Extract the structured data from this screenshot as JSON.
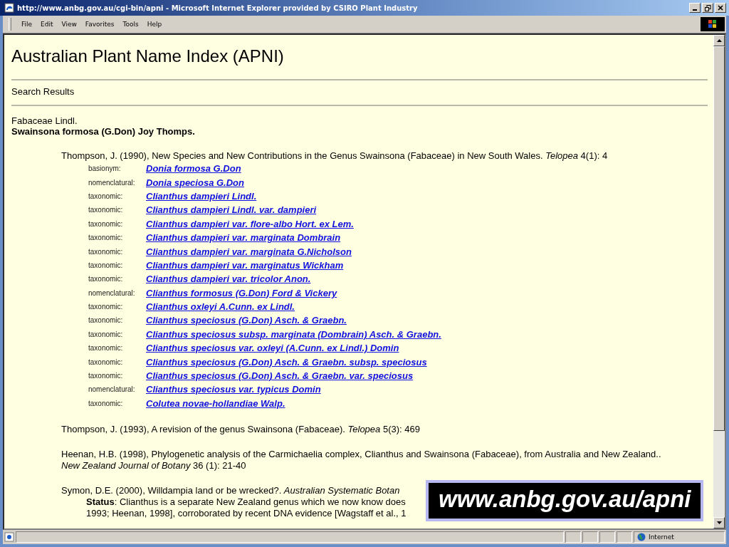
{
  "window": {
    "title": "http://www.anbg.gov.au/cgi-bin/apni - Microsoft Internet Explorer provided by CSIRO Plant Industry"
  },
  "menu": [
    {
      "label": "File"
    },
    {
      "label": "Edit"
    },
    {
      "label": "View"
    },
    {
      "label": "Favorites"
    },
    {
      "label": "Tools"
    },
    {
      "label": "Help"
    }
  ],
  "page": {
    "title": "Australian Plant Name Index (APNI)",
    "subtitle": "Search Results",
    "family": "Fabaceae Lindl.",
    "name": "Swainsona formosa (G.Don) Joy Thomps.",
    "references": [
      {
        "lines": [
          "Thompson, J. (1990), New Species and New Contributions in the Genus Swainsona (Fabaceae) in New South Wales. *Telopea* 4(1): 4"
        ],
        "relations": [
          {
            "type": "basionym:",
            "name": "Donia formosa G.Don"
          },
          {
            "type": "nomenclatural:",
            "name": "Donia speciosa G.Don"
          },
          {
            "type": "taxonomic:",
            "name": "Clianthus dampieri Lindl."
          },
          {
            "type": "taxonomic:",
            "name": "Clianthus dampieri Lindl. var. dampieri"
          },
          {
            "type": "taxonomic:",
            "name": "Clianthus dampieri var. flore-albo Hort. ex Lem."
          },
          {
            "type": "taxonomic:",
            "name": "Clianthus dampieri var. marginata Dombrain"
          },
          {
            "type": "taxonomic:",
            "name": "Clianthus dampieri var. marginata G.Nicholson"
          },
          {
            "type": "taxonomic:",
            "name": "Clianthus dampieri var. marginatus Wickham"
          },
          {
            "type": "taxonomic:",
            "name": "Clianthus dampieri var. tricolor Anon."
          },
          {
            "type": "nomenclatural:",
            "name": "Clianthus formosus (G.Don) Ford & Vickery"
          },
          {
            "type": "taxonomic:",
            "name": "Clianthus oxleyi A.Cunn. ex Lindl."
          },
          {
            "type": "taxonomic:",
            "name": "Clianthus speciosus (G.Don) Asch. & Graebn."
          },
          {
            "type": "taxonomic:",
            "name": "Clianthus speciosus subsp. marginata (Dombrain) Asch. & Graebn."
          },
          {
            "type": "taxonomic:",
            "name": "Clianthus speciosus var. oxleyi (A.Cunn. ex Lindl.) Domin"
          },
          {
            "type": "taxonomic:",
            "name": "Clianthus speciosus (G.Don) Asch. & Graebn. subsp. speciosus"
          },
          {
            "type": "taxonomic:",
            "name": "Clianthus speciosus (G.Don) Asch. & Graebn. var. speciosus"
          },
          {
            "type": "nomenclatural:",
            "name": "Clianthus speciosus var. typicus Domin"
          },
          {
            "type": "taxonomic:",
            "name": "Colutea novae-hollandiae Walp."
          }
        ]
      },
      {
        "lines": [
          "Thompson, J. (1993), A revision of the genus Swainsona (Fabaceae). *Telopea* 5(3): 469"
        ]
      },
      {
        "lines": [
          "Heenan, H.B. (1998), Phylogenetic analysis of the Carmichaelia complex, Clianthus and Swainsona (Fabaceae), from Australia and New Zealand..",
          "*New Zealand Journal of Botany* 36 (1): 21-40"
        ]
      },
      {
        "lines": [
          "Symon, D.E. (2000), Willdampia land or be wrecked?. *Australian Systematic Botan*"
        ],
        "notes": [
          "**Status**: Clianthus is a separate New Zealand genus which we now know does",
          "1993; Heenan, 1998], corroborated by recent DNA evidence [Wagstaff et al., 1"
        ]
      }
    ]
  },
  "banner": "www.anbg.gov.au/apni",
  "status_bar": {
    "zone": "Internet"
  }
}
